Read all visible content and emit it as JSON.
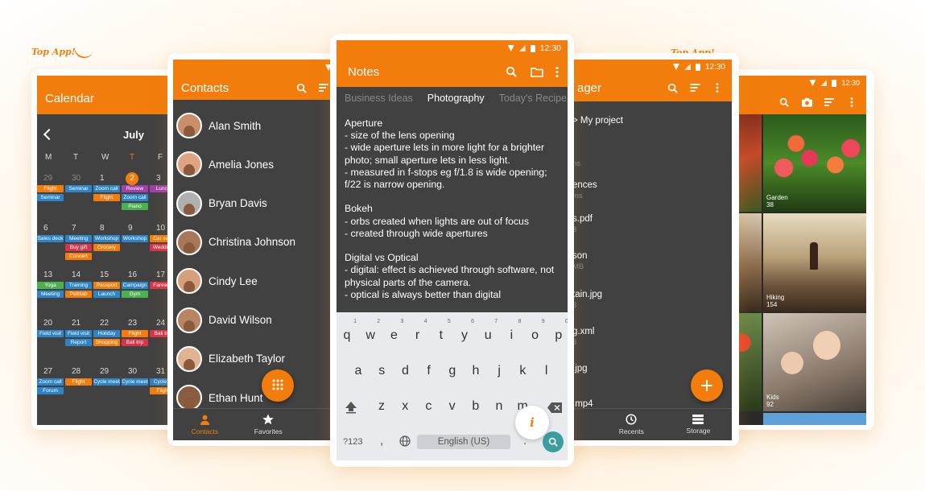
{
  "badges": {
    "left": "Top App!",
    "right": "Top App!"
  },
  "calendar": {
    "title": "Calendar",
    "month": "July",
    "weekdays": [
      "M",
      "T",
      "W",
      "T",
      "F"
    ],
    "days": [
      "29",
      "30",
      "1",
      "2",
      "3",
      "6",
      "7",
      "8",
      "9",
      "10",
      "13",
      "14",
      "15",
      "16",
      "17",
      "20",
      "21",
      "22",
      "23",
      "24",
      "27",
      "28",
      "29",
      "30",
      "31"
    ],
    "events": [
      "Flight",
      "Seminar",
      "Seminar",
      "Zoom call",
      "Flight",
      "Review",
      "Zoom call",
      "Piano",
      "Lunch",
      "Sales deck",
      "Meeting",
      "Buy gift",
      "Concert",
      "Workshop",
      "Grocery",
      "Workshop",
      "Car serv",
      "Wedding",
      "Yoga",
      "Meeting",
      "Training",
      "Pathlab",
      "Passport",
      "Launch",
      "Campaign",
      "Gym",
      "Farewell",
      "Field visit",
      "Field visit",
      "Report",
      "Holiday",
      "Shopping",
      "Flight",
      "Bali trip",
      "Bali trip",
      "Zoom call",
      "Forum",
      "Flight",
      "Cycle meet",
      "Cycle meet",
      "Cycle m",
      "Flight"
    ]
  },
  "contacts": {
    "title": "Contacts",
    "list": [
      "Alan Smith",
      "Amelia Jones",
      "Bryan Davis",
      "Christina Johnson",
      "Cindy Lee",
      "David Wilson",
      "Elizabeth Taylor",
      "Ethan Hunt"
    ],
    "nav": {
      "contacts": "Contacts",
      "favorites": "Favorites"
    }
  },
  "notes": {
    "time": "12:30",
    "title": "Notes",
    "tabs": [
      "Business Ideas",
      "Photography",
      "Today's Recipe"
    ],
    "body": "Aperture\n- size of the lens opening\n- wide aperture lets in more light for a brighter photo; small aperture lets in less light.\n- measured in f-stops eg f/1.8 is wide opening; f/22 is narrow opening.\n\nBokeh\n- orbs created when lights are out of focus\n- created through wide apertures\n\nDigital vs Optical\n- digital: effect is achieved through software, not physical parts of the camera.\n- optical is always better than digital",
    "keyboard": {
      "row1": [
        "q",
        "w",
        "e",
        "r",
        "t",
        "y",
        "u",
        "i",
        "o",
        "p"
      ],
      "row1_nums": [
        "1",
        "2",
        "3",
        "4",
        "5",
        "6",
        "7",
        "8",
        "9",
        "0"
      ],
      "row2": [
        "a",
        "s",
        "d",
        "f",
        "g",
        "h",
        "j",
        "k",
        "l"
      ],
      "row3": [
        "z",
        "x",
        "c",
        "v",
        "b",
        "n",
        "m"
      ],
      "sym": "?123",
      "comma": ",",
      "space": "English (US)",
      "period": "."
    }
  },
  "files": {
    "time": "12:30",
    "title_partial": "ager",
    "breadcrumb": "> My project",
    "items": [
      {
        "name": "",
        "meta": "ns"
      },
      {
        "name": "ences",
        "meta": "ms"
      },
      {
        "name": "s.pdf",
        "meta": "3"
      },
      {
        "name": "son",
        "meta": "MB"
      },
      {
        "name": "tain.jpg",
        "meta": "3"
      },
      {
        "name": "g.xml",
        "meta": "3"
      },
      {
        "name": ".jpg",
        "meta": ""
      },
      {
        "name": ".mp4",
        "meta": ""
      }
    ],
    "nav": {
      "recents": "Recents",
      "storage": "Storage"
    }
  },
  "gallery": {
    "time": "12:30",
    "albums": [
      {
        "name": "Garden",
        "count": "38"
      },
      {
        "name": "Hiking",
        "count": "154"
      },
      {
        "name": "Kids",
        "count": "92"
      }
    ]
  },
  "colors": {
    "accent": "#f27d0c",
    "dark": "#414141"
  }
}
